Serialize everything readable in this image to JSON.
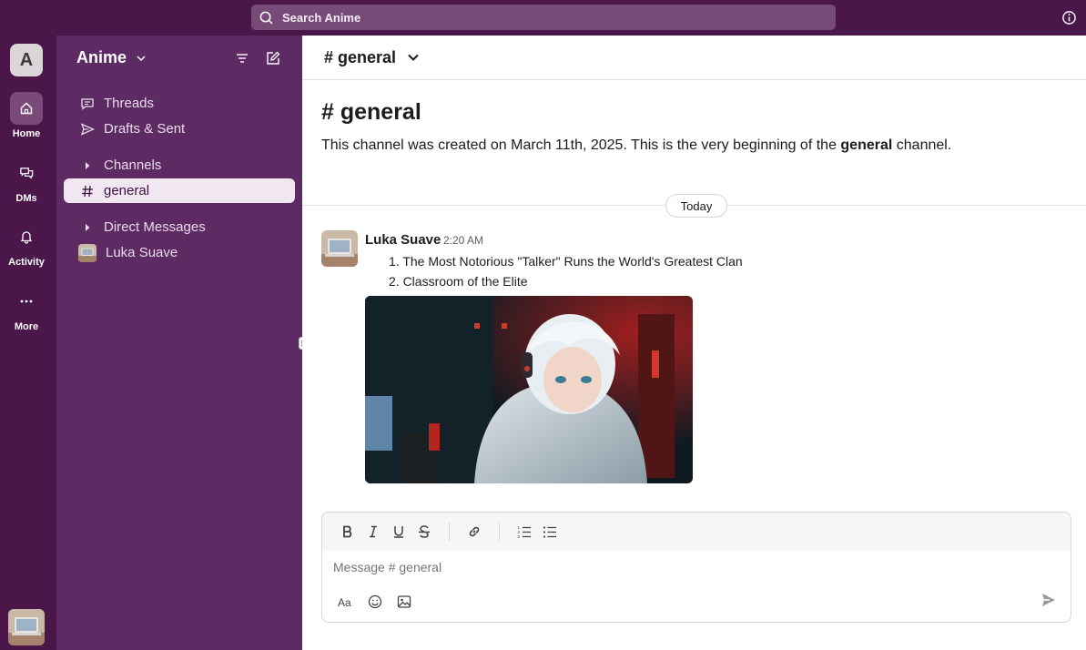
{
  "topbar": {
    "search_label": "Search Anime"
  },
  "rail": {
    "workspace_initial": "A",
    "items": [
      {
        "label": "Home",
        "icon": "home-icon"
      },
      {
        "label": "DMs",
        "icon": "dms-icon"
      },
      {
        "label": "Activity",
        "icon": "bell-icon"
      },
      {
        "label": "More",
        "icon": "more-icon"
      }
    ]
  },
  "sidebar": {
    "workspace_name": "Anime",
    "threads": "Threads",
    "drafts": "Drafts & Sent",
    "channels_header": "Channels",
    "channel": "general",
    "dm_header": "Direct Messages",
    "dm_user": "Luka Suave"
  },
  "header": {
    "channel_title": "# general"
  },
  "intro": {
    "title": "# general",
    "text_before": "This channel was created on March 11th, 2025. This is the very beginning of the ",
    "text_bold": "general",
    "text_after": " channel."
  },
  "divider_label": "Today",
  "message": {
    "author": "Luka Suave",
    "time": "2:20 AM",
    "items": [
      "1. The Most Notorious \"Talker\" Runs the World's Greatest Clan",
      "2. Classroom of the Elite"
    ]
  },
  "composer": {
    "placeholder": "Message # general"
  },
  "colors": {
    "rail": "#4b174b",
    "sidebar": "#5e2a63",
    "accent": "#4a154b"
  }
}
